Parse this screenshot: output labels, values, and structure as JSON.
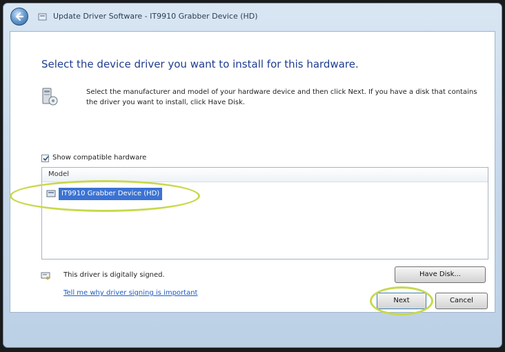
{
  "window": {
    "title": "Update Driver Software - IT9910 Grabber Device (HD)"
  },
  "main": {
    "heading": "Select the device driver you want to install for this hardware.",
    "description": "Select the manufacturer and model of your hardware device and then click Next. If you have a disk that contains the driver you want to install, click Have Disk.",
    "show_compatible_label": "Show compatible hardware",
    "show_compatible_checked": true,
    "model_list": {
      "header": "Model",
      "items": [
        {
          "label": "IT9910 Grabber Device (HD)",
          "selected": true
        }
      ]
    },
    "driver_signed_text": "This driver is digitally signed.",
    "driver_signing_link": "Tell me why driver signing is important",
    "have_disk_label": "Have Disk..."
  },
  "footer": {
    "next_label": "Next",
    "cancel_label": "Cancel"
  },
  "colors": {
    "heading": "#1e3d8f",
    "selection": "#3b73d3",
    "highlight_annotation": "#c9d84a",
    "link": "#1a5cc4"
  },
  "icons": {
    "back": "back-arrow-icon",
    "title": "driver-package-icon",
    "hardware": "hardware-device-icon",
    "model_item": "device-icon",
    "signed": "certificate-icon"
  }
}
